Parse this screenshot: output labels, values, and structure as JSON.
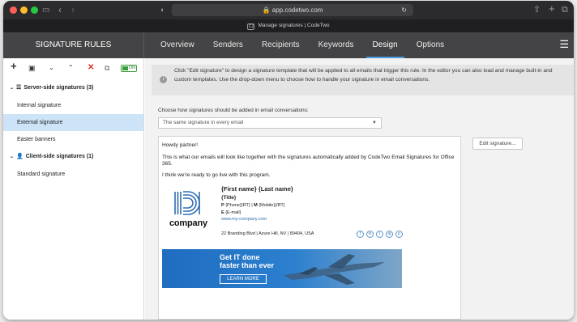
{
  "browser": {
    "url": "app.codetwo.com",
    "tab_title": "Manage signatures | CodeTwo",
    "tab_favicon": "C2"
  },
  "app": {
    "title": "SIGNATURE RULES",
    "tabs": [
      "Overview",
      "Senders",
      "Recipients",
      "Keywords",
      "Design",
      "Options"
    ],
    "active_tab": "Design",
    "accent_color": "#4f9be0"
  },
  "sidebar": {
    "toggle_label": "ON",
    "groups": [
      {
        "label": "Server-side signatures (3)",
        "icon": "list-icon"
      },
      {
        "label": "Client-side signatures (1)",
        "icon": "user-icon"
      }
    ],
    "items": [
      "Internal signature",
      "External signature",
      "Easter banners",
      "Standard signature"
    ],
    "selected_item": "External signature"
  },
  "main": {
    "info_text": "Click \"Edit signature\" to design a signature template that will be applied to all emails that trigger this rule. In the editor you can also load and manage built-in and custom templates. Use the drop-down menu to choose how to handle your signature in email conversations.",
    "conversation_label": "Choose how signatures should be added in email conversations:",
    "conversation_value": "The same signature in every email",
    "edit_button": "Edit signature..."
  },
  "preview": {
    "greeting": "Howdy partner!",
    "line1": "This is what our emails will look like together with the signatures automatically added by CodeTwo Email Signatures for Office",
    "line1b": "365.",
    "line2": "I think we're ready to go live with this program.",
    "logo_text": "company",
    "name": "{First name} {Last name}",
    "title": "{Title}",
    "phone_label": "P",
    "phone_value": "{Phone}{RT} | ",
    "mobile_label": "M",
    "mobile_value": "{Mobile}{/RT}",
    "email_label": "E",
    "email_value": "{E-mail}",
    "website": "www.my-company.com",
    "address": "22 Branding Blvd | Azure Hill, NV | 89404, USA",
    "social": [
      "f",
      "in",
      "t",
      "ig",
      "p"
    ],
    "banner_line1": "Get IT done",
    "banner_line2": "faster than ever",
    "banner_button": "LEARN MORE"
  }
}
